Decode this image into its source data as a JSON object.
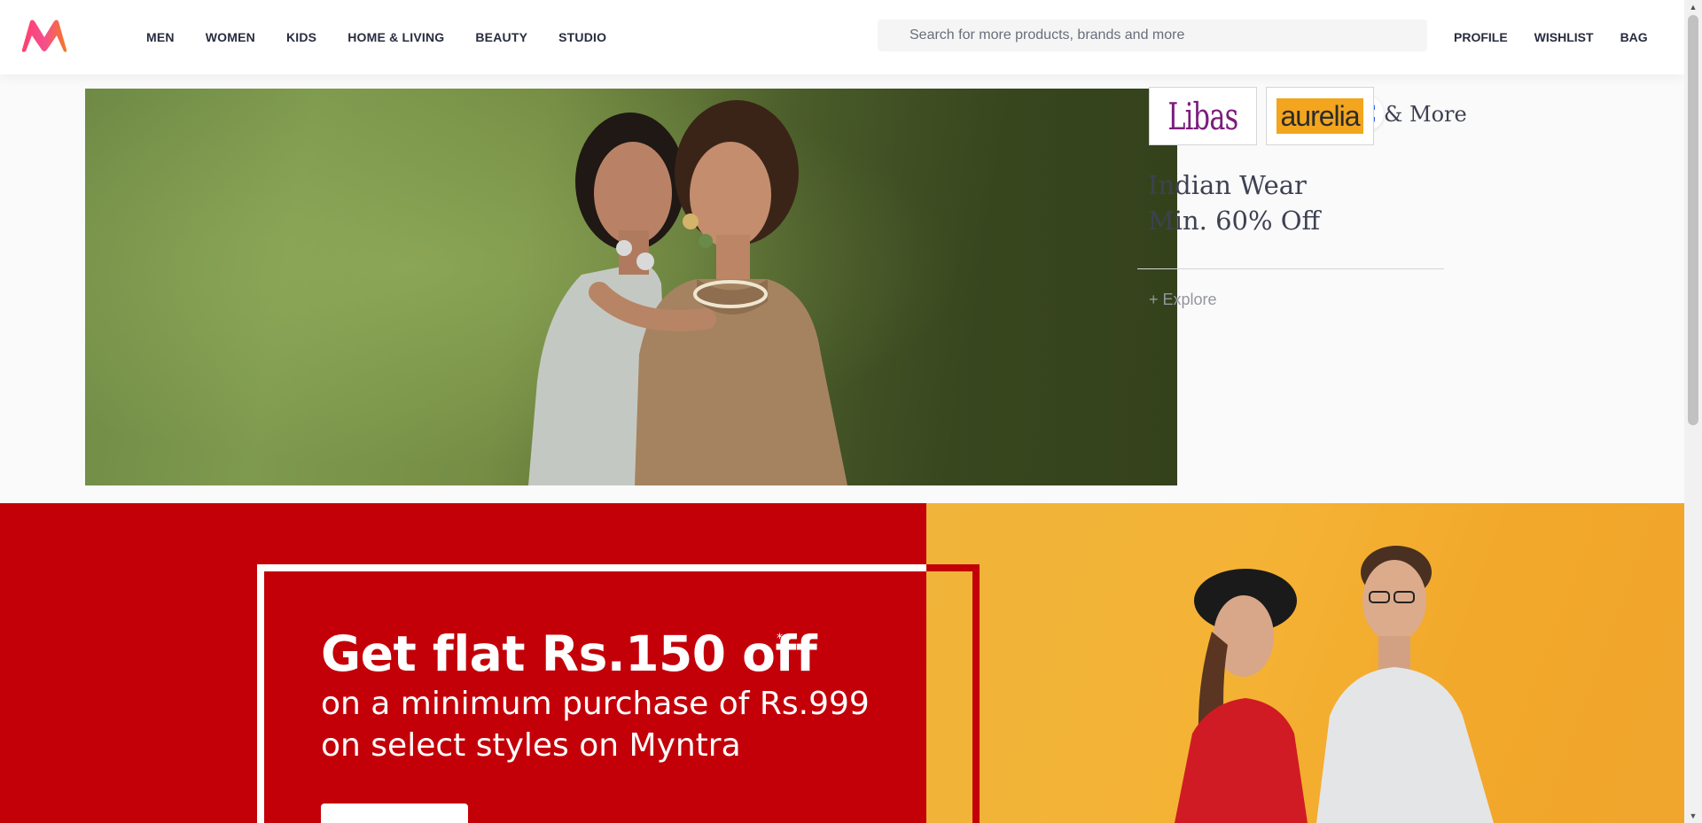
{
  "header": {
    "nav": [
      "MEN",
      "WOMEN",
      "KIDS",
      "HOME & LIVING",
      "BEAUTY",
      "STUDIO"
    ],
    "search_placeholder": "Search for more products, brands and more",
    "profile_label": "PROFILE",
    "wishlist_label": "WISHLIST",
    "bag_label": "BAG"
  },
  "banner1": {
    "brands": [
      "Libas",
      "aurelia"
    ],
    "more_text": "& More",
    "offer_line1": "Indian Wear",
    "offer_line2": "Min. 60% Off",
    "explore_label": "+ Explore"
  },
  "banner2": {
    "headline": "Get flat Rs.150 off",
    "asterisk": "*",
    "subline1": "on a minimum purchase of Rs.999",
    "subline2": "on select styles on Myntra"
  },
  "colors": {
    "brand_pink": "#ff3f6c",
    "brand_orange": "#f37a24",
    "promo_red": "#c30008",
    "promo_yellow": "#f4b335",
    "libas_purple": "#7b1c7e",
    "aurelia_orange": "#f2a51d"
  },
  "icons": {
    "logo": "myntra-logo",
    "scan": "visual-search-scan-icon",
    "scroll_up": "arrow-up-icon",
    "scroll_down": "arrow-down-icon"
  }
}
